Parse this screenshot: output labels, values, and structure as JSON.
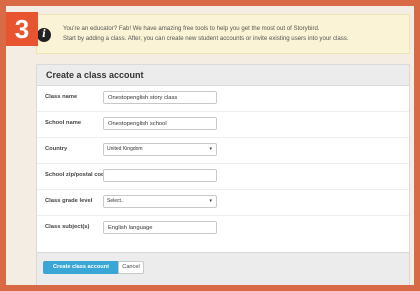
{
  "step_badge": "3",
  "notice": {
    "icon": "info-icon",
    "line1": "You're an educator? Fab! We have amazing free tools to help you get the most out of Storybird.",
    "line2": "Start by adding a class. After, you can create new student accounts or invite existing users into your class."
  },
  "form": {
    "title": "Create a class account",
    "fields": [
      {
        "label": "Class name",
        "value": "Onestopenglish story class",
        "placeholder": ""
      },
      {
        "label": "School name",
        "value": "Onestopenglish school",
        "placeholder": ""
      },
      {
        "label": "Country",
        "selected": "United Kingdom"
      },
      {
        "label": "School zip/postal code",
        "value": "",
        "placeholder": ""
      },
      {
        "label": "Class grade level",
        "selected": "Select.."
      },
      {
        "label": "Class subject(s)",
        "value": "English language",
        "placeholder": ""
      }
    ],
    "submit_label": "Create class account",
    "cancel_label": "Cancel"
  },
  "colors": {
    "background": "#d86a45",
    "badge": "#e8542f",
    "primary_button": "#3aa6d6",
    "notice_bg": "#fbf3d5"
  }
}
